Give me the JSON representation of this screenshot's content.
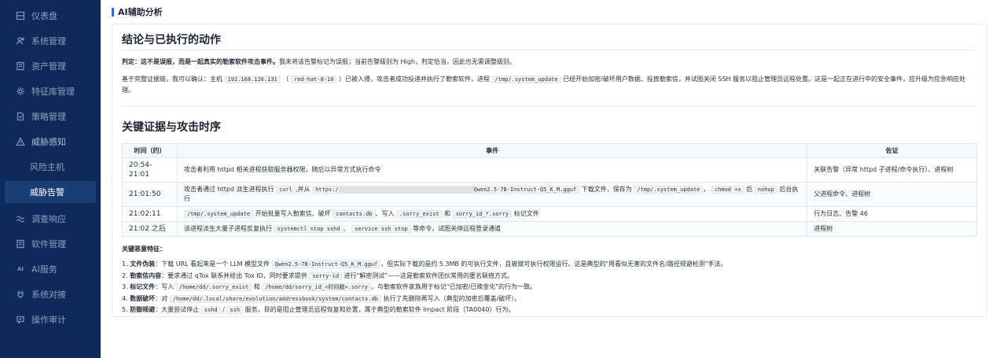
{
  "sidebar": {
    "items": [
      {
        "label": "仪表盘",
        "icon": "dashboard-icon"
      },
      {
        "label": "系统管理",
        "icon": "users-icon"
      },
      {
        "label": "资产管理",
        "icon": "asset-icon"
      },
      {
        "label": "特征库管理",
        "icon": "gear-icon"
      },
      {
        "label": "策略管理",
        "icon": "policy-icon"
      },
      {
        "label": "威胁感知",
        "icon": "warning-icon"
      }
    ],
    "sub_items": [
      {
        "label": "风险主机"
      },
      {
        "label": "威胁告警"
      }
    ],
    "items_after": [
      {
        "label": "调查响应",
        "icon": "investigate-icon"
      },
      {
        "label": "软件管理",
        "icon": "software-icon"
      },
      {
        "label": "AI服务",
        "icon": "ai-icon"
      },
      {
        "label": "系统对接",
        "icon": "plug-icon"
      },
      {
        "label": "操作审计",
        "icon": "audit-icon"
      }
    ]
  },
  "page": {
    "section_title": "AI辅助分析"
  },
  "conclusion": {
    "heading": "结论与已执行的动作",
    "verdict_bold": "判定：这不是误报，而是一起真实的勒索软件攻击事件。",
    "verdict_rest": "我未将该告警标记为误报；当前告警级别为 High，判定恰当，因此也无需调整级别。",
    "p2_a": "基于完整证据链，我可以确认：主机",
    "p2_ip": "192.168.126.131",
    "p2_b": "（",
    "p2_host": "red-hat-8-10",
    "p2_c": "）已被入侵，攻击者成功投递并执行了勒索软件，进程",
    "p2_proc": "/tmp/.system_update",
    "p2_d": "已经开始加密/破坏用户数据、投放勒索信，并试图关闭 SSH 服务以阻止管理员远程处置。这是一起正在进行中的安全事件，应升级为应急响应处理。"
  },
  "timeline": {
    "heading": "关键证据与攻击时序",
    "columns": [
      "时间（约）",
      "事件",
      "佐证"
    ],
    "rows": [
      {
        "time": "20:54-21:01",
        "event": "攻击者利用 httpd 相关进程获取服务器权限，随后以异常方式执行命令",
        "evidence": "关联告警（异常 httpd 子进程/命令执行）、进程树"
      },
      {
        "time": "21:01:50",
        "event_a": "攻击者通过 httpd 派生进程执行",
        "event_curl": "curl",
        "event_b": ",并从",
        "event_url_start": "https:/",
        "event_url_end": "Qwen2.5-7B-Instruct-Q5_K_M.gguf",
        "event_c": "下载文件，保存为",
        "event_path": "/tmp/.system_update",
        "event_d": "，",
        "event_chmod": "chmod +x",
        "event_e": "后",
        "event_nohup": "nohup",
        "event_f": "后台执行",
        "evidence": "父进程命令、进程树"
      },
      {
        "time": "21:02:11",
        "event_proc": "/tmp/.system_update",
        "event_a": "开始批量写入勒索信、破坏",
        "event_contacts": "contacts.db",
        "event_b": "、写入",
        "event_exist": ".sorry_exist",
        "event_c": "和",
        "event_sorryid": "sorry_id_*.sorry",
        "event_d": "标记文件",
        "evidence": "行为日志、告警 46"
      },
      {
        "time": "21:02 之后",
        "event_a": "该进程派生大量子进程反复执行",
        "event_stop1": "systemctl stop sshd",
        "event_b": "、",
        "event_stop2": "service ssh stop",
        "event_c": "等命令，试图关停远程登录通道",
        "evidence": "进程树"
      }
    ]
  },
  "features": {
    "title": "关键恶意特征：",
    "items": [
      {
        "num": "1.",
        "label": "文件伪装",
        "a": "：下载 URL 看起来是一个 LLM 模型文件",
        "code": "Qwen2.5-7B-Instruct-Q5_K_M.gguf",
        "b": "，但实际下载的是约 5.3MB 的可执行文件，且被赋可执行权限运行。这是典型的\"用看似无害的文件名/路径规避检测\"手法。"
      },
      {
        "num": "2.",
        "label": "勒索信内容",
        "a": "：要求通过 qTox 联系并给出 Tox ID，同时要求提供",
        "code": "sorry-id",
        "b": "进行\"解密测试\"——这是勒索软件团伙常用的匿名联络方式。"
      },
      {
        "num": "3.",
        "label": "标记文件",
        "a": "：写入",
        "code": "/home/dd/.sorry_exist",
        "b": "和",
        "code2": "/home/dd/sorry_id_<时间戳>.sorry",
        "c": "，与勒索软件家族用于标记\"已加密/已赎金化\"的行为一致。"
      },
      {
        "num": "4.",
        "label": "数据破坏",
        "a": "：对",
        "code": "/home/dd/.local/share/evolution/addressbook/system/contacts.db",
        "b": "执行了先删除再写入（典型的加密后覆盖/破坏）。"
      },
      {
        "num": "5.",
        "label": "防御规避",
        "a": "：大量尝试停止",
        "code": "sshd",
        "sep": "/",
        "code2": "ssh",
        "b": "服务，目的是阻止管理员远程恢复和处置，属于典型的勒索软件 Impact 阶段（TA0040）行为。"
      }
    ]
  }
}
